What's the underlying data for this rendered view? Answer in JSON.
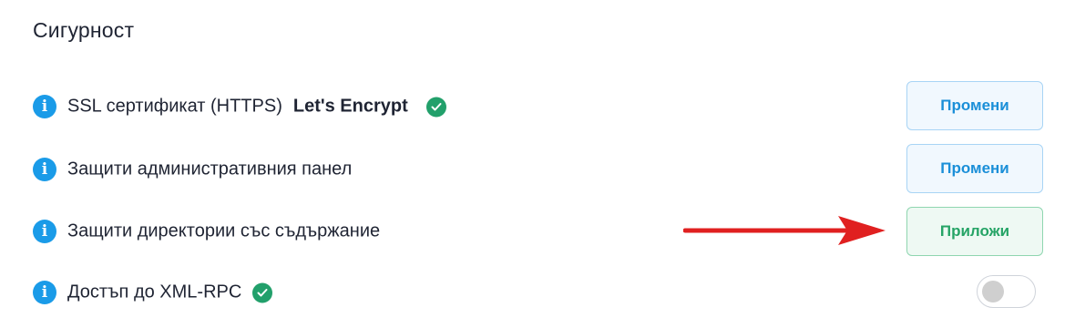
{
  "section": {
    "title": "Сигурност"
  },
  "rows": [
    {
      "label": "SSL сертификат (HTTPS)",
      "value": "Let's Encrypt",
      "button": "Промени",
      "verified": true
    },
    {
      "label": "Защити административния панел",
      "button": "Промени"
    },
    {
      "label": "Защити директории със съдържание",
      "button": "Приложи"
    },
    {
      "label": "Достъп до XML-RPC",
      "verified": true,
      "toggle_on": false
    }
  ],
  "colors": {
    "info": "#1a9be8",
    "check": "#22a06b",
    "blue_button_text": "#1b8fd8",
    "green_button_text": "#26a466",
    "arrow": "#e02020"
  },
  "icons": {
    "info": "info-circle-icon",
    "check": "check-circle-icon",
    "arrow": "red-arrow-icon"
  }
}
